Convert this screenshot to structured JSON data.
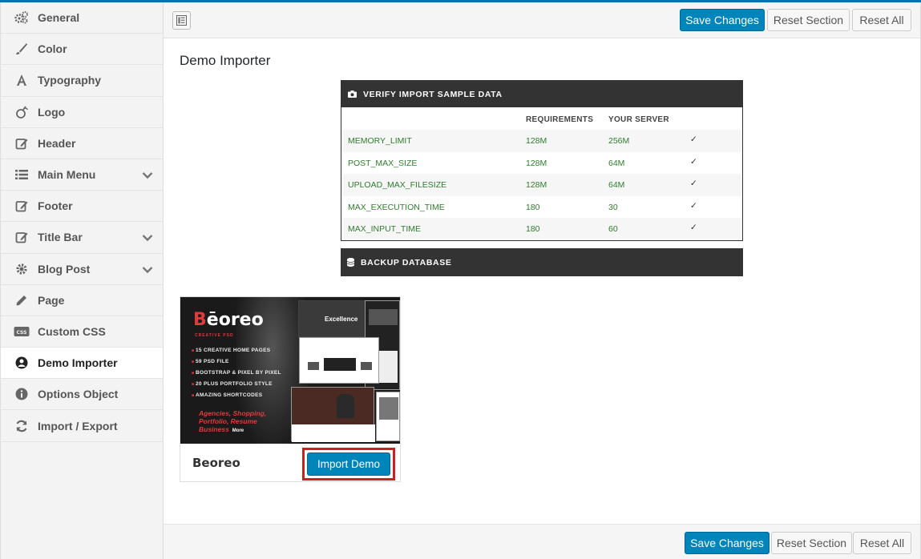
{
  "sidebar": {
    "items": [
      {
        "label": "General",
        "icon": "gears-icon",
        "has_chevron": false
      },
      {
        "label": "Color",
        "icon": "brush-icon",
        "has_chevron": false
      },
      {
        "label": "Typography",
        "icon": "font-icon",
        "has_chevron": false
      },
      {
        "label": "Logo",
        "icon": "apple-icon",
        "has_chevron": false
      },
      {
        "label": "Header",
        "icon": "edit-icon",
        "has_chevron": false
      },
      {
        "label": "Main Menu",
        "icon": "list-icon",
        "has_chevron": true
      },
      {
        "label": "Footer",
        "icon": "edit-icon",
        "has_chevron": false
      },
      {
        "label": "Title Bar",
        "icon": "edit-icon",
        "has_chevron": true
      },
      {
        "label": "Blog Post",
        "icon": "gear-icon",
        "has_chevron": true
      },
      {
        "label": "Page",
        "icon": "pencil-icon",
        "has_chevron": false
      },
      {
        "label": "Custom CSS",
        "icon": "css-icon",
        "has_chevron": false
      },
      {
        "label": "Demo Importer",
        "icon": "user-download-icon",
        "has_chevron": false,
        "active": true
      },
      {
        "label": "Options Object",
        "icon": "info-icon",
        "has_chevron": false
      },
      {
        "label": "Import / Export",
        "icon": "refresh-icon",
        "has_chevron": false
      }
    ]
  },
  "toolbar": {
    "save_label": "Save Changes",
    "reset_section_label": "Reset Section",
    "reset_all_label": "Reset All"
  },
  "page": {
    "title": "Demo Importer"
  },
  "verify": {
    "heading": "VERIFY IMPORT SAMPLE DATA",
    "col_requirements": "REQUIREMENTS",
    "col_server": "YOUR SERVER",
    "rows": [
      {
        "name": "MEMORY_LIMIT",
        "required": "128M",
        "server": "256M",
        "ok": "✓"
      },
      {
        "name": "POST_MAX_SIZE",
        "required": "128M",
        "server": "64M",
        "ok": "✓"
      },
      {
        "name": "UPLOAD_MAX_FILESIZE",
        "required": "128M",
        "server": "64M",
        "ok": "✓"
      },
      {
        "name": "MAX_EXECUTION_TIME",
        "required": "180",
        "server": "30",
        "ok": "✓"
      },
      {
        "name": "MAX_INPUT_TIME",
        "required": "180",
        "server": "60",
        "ok": "✓"
      }
    ]
  },
  "backup": {
    "heading": "BACKUP DATABASE"
  },
  "demo": {
    "name": "Beoreo",
    "import_label": "Import Demo",
    "preview": {
      "brand_first": "B",
      "brand_rest": "ēoreo",
      "brand_sub": "CREATIVE PSD",
      "features": [
        "15 CREATIVE HOME PAGES",
        "59 PSD FILE",
        "BOOTSTRAP & PIXEL BY PIXEL",
        "20 PLUS PORTFOLIO STYLE",
        "AMAZING SHORTCODES"
      ],
      "tagline": "Agencies, Shopping, Portfolio, Resume Business",
      "more": "More",
      "mock_headline": "Excellence"
    }
  },
  "colors": {
    "accent": "#0085ba",
    "dark_panel": "#333333",
    "ok_green": "#2e7d2e",
    "highlight_red": "#cc1f1f"
  }
}
